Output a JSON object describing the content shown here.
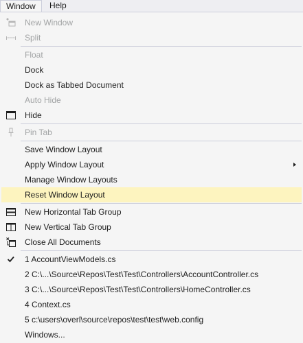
{
  "menubar": {
    "items": [
      {
        "label": "Window"
      },
      {
        "label": "Help"
      }
    ]
  },
  "menu": {
    "new_window": "New Window",
    "split": "Split",
    "float": "Float",
    "dock": "Dock",
    "dock_tabbed": "Dock as Tabbed Document",
    "auto_hide": "Auto Hide",
    "hide": "Hide",
    "pin_tab": "Pin Tab",
    "save_layout": "Save Window Layout",
    "apply_layout": "Apply Window Layout",
    "manage_layouts": "Manage Window Layouts",
    "reset_layout": "Reset Window Layout",
    "new_h_group": "New Horizontal Tab Group",
    "new_v_group": "New Vertical Tab Group",
    "close_all": "Close All Documents",
    "recent": [
      "1 AccountViewModels.cs",
      "2 C:\\...\\Source\\Repos\\Test\\Test\\Controllers\\AccountController.cs",
      "3 C:\\...\\Source\\Repos\\Test\\Test\\Controllers\\HomeController.cs",
      "4 Context.cs",
      "5 c:\\users\\overl\\source\\repos\\test\\test\\web.config"
    ],
    "windows": "Windows..."
  },
  "colors": {
    "highlight": "#fdf4bf",
    "disabled_text": "#a2a4a5",
    "separator": "#cccedb"
  }
}
